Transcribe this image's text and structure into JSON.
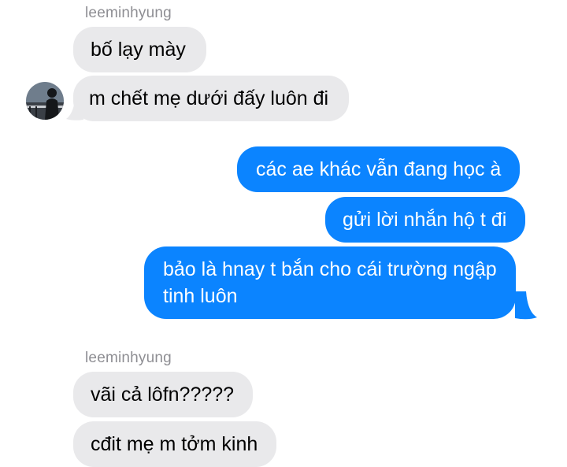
{
  "conversation": {
    "messages": [
      {
        "sender_label": "leeminhyung"
      },
      {
        "text": "bố lạy mày"
      },
      {
        "text": "m chết mẹ dưới đấy luôn đi"
      },
      {
        "text": "các ae khác vẫn đang học à"
      },
      {
        "text": "gửi lời nhắn hộ t đi"
      },
      {
        "text_line1": "bảo là hnay t bắn cho cái trường ngập",
        "text_line2": "tinh luôn"
      },
      {
        "sender_label": "leeminhyung"
      },
      {
        "text": "vãi cả lôfn?????"
      },
      {
        "text": "cđit mẹ m tởm kinh"
      }
    ]
  },
  "colors": {
    "incoming_bubble": "#e9e9eb",
    "outgoing_bubble": "#0b84ff",
    "sender_label": "#8e8e93"
  }
}
